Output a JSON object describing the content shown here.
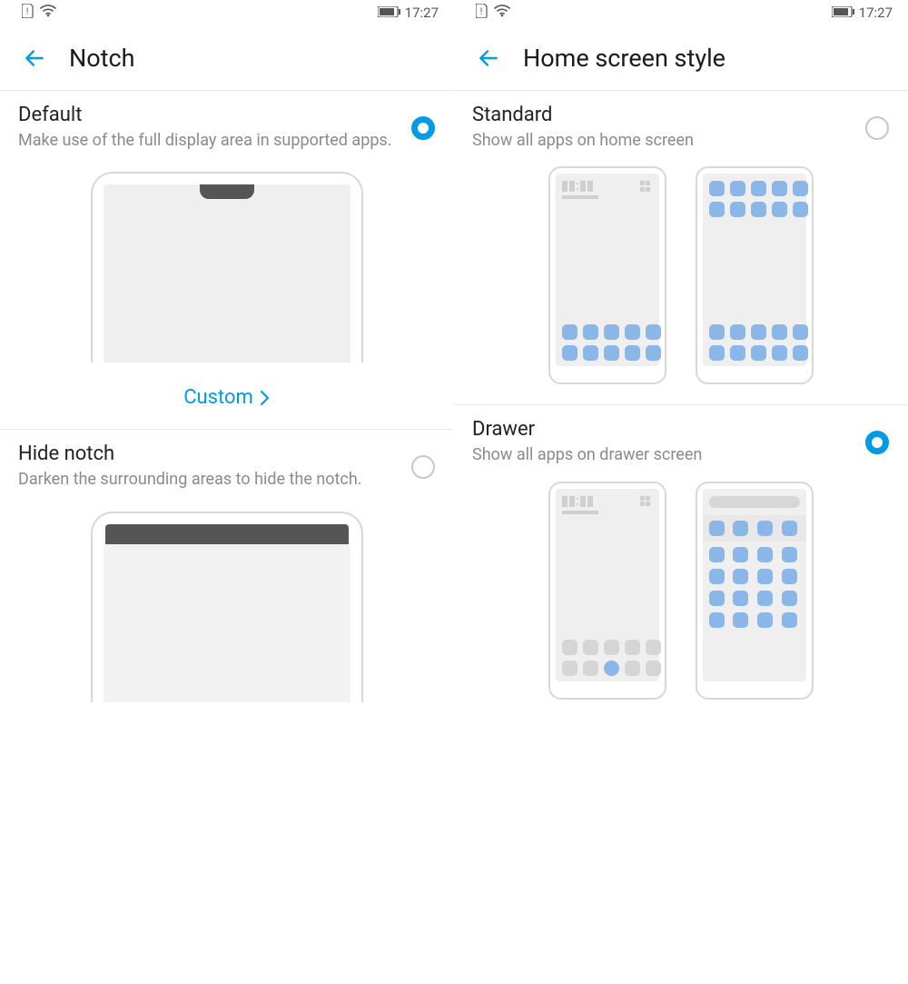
{
  "status": {
    "time": "17:27"
  },
  "left_screen": {
    "title": "Notch",
    "options": {
      "default": {
        "title": "Default",
        "subtitle": "Make use of the full display area in supported apps.",
        "selected": true,
        "custom_link": "Custom"
      },
      "hide": {
        "title": "Hide notch",
        "subtitle": "Darken the surrounding areas to hide the notch.",
        "selected": false
      }
    }
  },
  "right_screen": {
    "title": "Home screen style",
    "options": {
      "standard": {
        "title": "Standard",
        "subtitle": "Show all apps on home screen",
        "selected": false
      },
      "drawer": {
        "title": "Drawer",
        "subtitle": "Show all apps on drawer screen",
        "selected": true
      }
    }
  }
}
